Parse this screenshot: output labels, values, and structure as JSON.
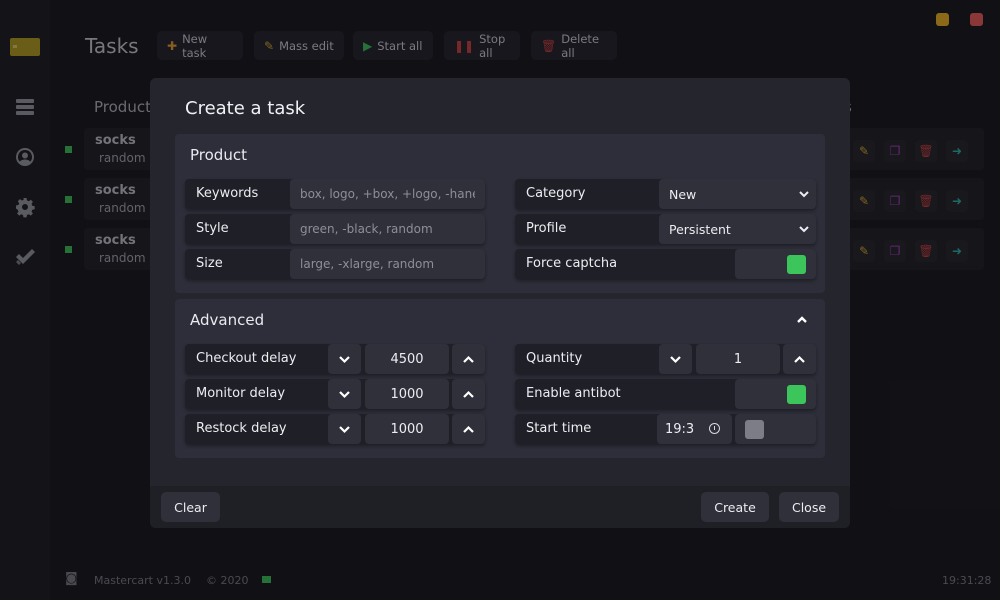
{
  "app": {
    "title": "Tasks",
    "icons": {
      "logo": "card-logo-icon",
      "window_min": "minimize-icon",
      "window_close": "close-icon"
    },
    "colors": {
      "accent_green": "#3cc55a",
      "minimize": "#f5b623",
      "close": "#f25c5c",
      "toggle_off": "#7d7d88"
    }
  },
  "sidebar": {
    "items": [
      {
        "name": "sidebar-item-tasks",
        "icon": "list-icon"
      },
      {
        "name": "sidebar-item-profiles",
        "icon": "user-circle-icon"
      },
      {
        "name": "sidebar-item-settings",
        "icon": "gear-icon"
      },
      {
        "name": "sidebar-item-checkouts",
        "icon": "double-check-icon"
      }
    ]
  },
  "toolbar": {
    "new_task": "New task",
    "mass_edit": "Mass edit",
    "start_all": "Start all",
    "stop_all": "Stop all",
    "delete_all": "Delete all"
  },
  "table": {
    "headers": {
      "product": "Product",
      "actions_partial": "s"
    },
    "rows": [
      {
        "name": "socks",
        "size": "random"
      },
      {
        "name": "socks",
        "size": "random"
      },
      {
        "name": "socks",
        "size": "random"
      }
    ]
  },
  "footer": {
    "version": "Mastercart v1.3.0",
    "copyright": "© 2020",
    "clock": "19:31:28"
  },
  "modal": {
    "title": "Create a task",
    "product": {
      "title": "Product",
      "keywords": {
        "label": "Keywords",
        "placeholder": "box, logo, +box, +logo, -hanes"
      },
      "style": {
        "label": "Style",
        "placeholder": "green, -black, random"
      },
      "size": {
        "label": "Size",
        "placeholder": "large, -xlarge, random"
      },
      "category": {
        "label": "Category",
        "value": "New"
      },
      "profile": {
        "label": "Profile",
        "value": "Persistent"
      },
      "force_captcha": {
        "label": "Force captcha",
        "on": true
      }
    },
    "advanced": {
      "title": "Advanced",
      "checkout_delay": {
        "label": "Checkout delay",
        "value": "4500"
      },
      "monitor_delay": {
        "label": "Monitor delay",
        "value": "1000"
      },
      "restock_delay": {
        "label": "Restock delay",
        "value": "1000"
      },
      "quantity": {
        "label": "Quantity",
        "value": "1"
      },
      "enable_antibot": {
        "label": "Enable antibot",
        "on": true
      },
      "start_time": {
        "label": "Start time",
        "value": "19:3",
        "enabled": false
      }
    },
    "buttons": {
      "clear": "Clear",
      "create": "Create",
      "close": "Close"
    }
  }
}
